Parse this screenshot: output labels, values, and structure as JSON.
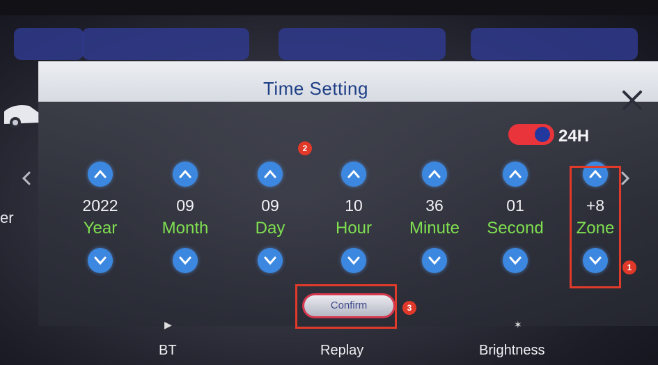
{
  "dialog": {
    "title": "Time Setting",
    "close_icon": "close-icon",
    "format_toggle": {
      "label": "24H",
      "on": true,
      "color_on": "#e8343a"
    },
    "fields": [
      {
        "id": "year",
        "value": "2022",
        "label": "Year"
      },
      {
        "id": "month",
        "value": "09",
        "label": "Month"
      },
      {
        "id": "day",
        "value": "09",
        "label": "Day"
      },
      {
        "id": "hour",
        "value": "10",
        "label": "Hour"
      },
      {
        "id": "minute",
        "value": "36",
        "label": "Minute"
      },
      {
        "id": "second",
        "value": "01",
        "label": "Second"
      },
      {
        "id": "zone",
        "value": "+8",
        "label": "Zone"
      }
    ],
    "confirm_label": "Confirm"
  },
  "annotations": [
    "1",
    "2",
    "3"
  ],
  "background": {
    "partial_text": "er",
    "bottom_items": [
      "BT",
      "Replay",
      "Brightness"
    ]
  },
  "colors": {
    "label_green": "#7fe050",
    "arrow_blue": "#3c88e0",
    "title_blue": "#1e3f86",
    "annotation_red": "#e03a2a"
  }
}
